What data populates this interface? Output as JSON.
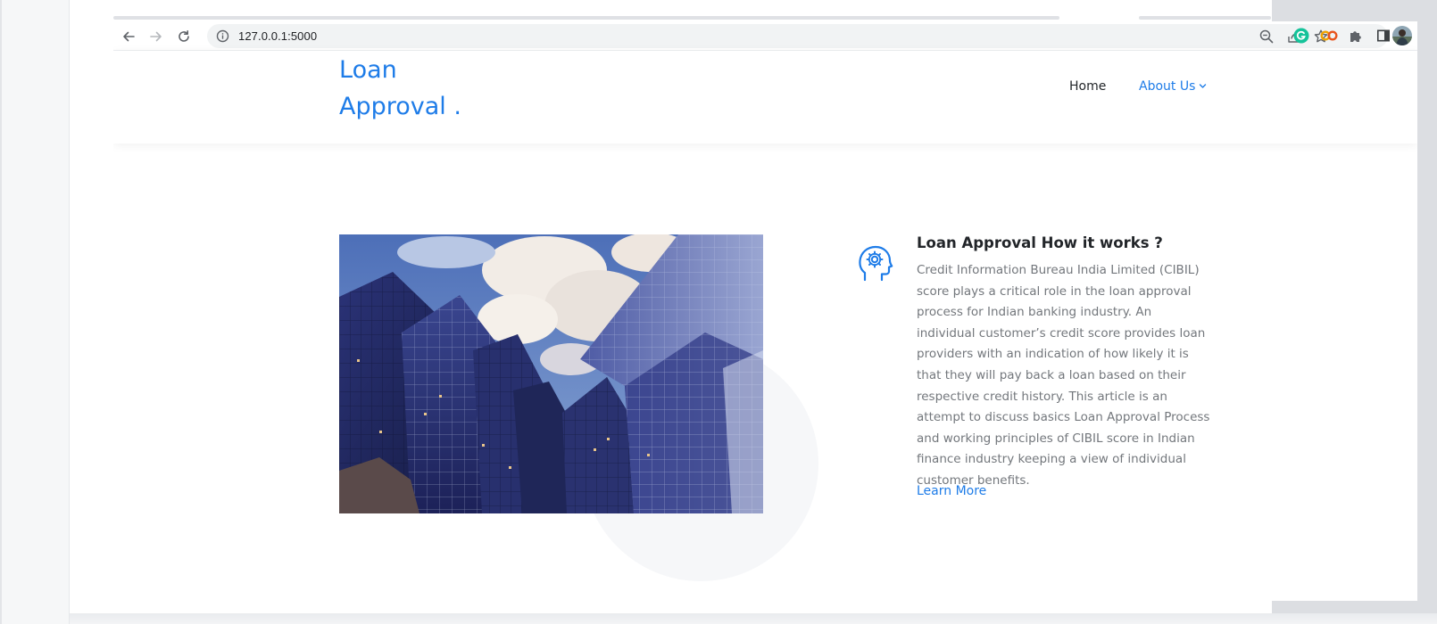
{
  "browser": {
    "url": "127.0.0.1:5000",
    "icons": [
      "back-arrow-icon",
      "forward-arrow-icon",
      "reload-icon",
      "site-info-icon",
      "zoom-icon",
      "share-icon",
      "bookmark-star-icon",
      "grammarly-icon",
      "coupon-extension-icon",
      "extensions-puzzle-icon",
      "side-panel-icon",
      "profile-avatar"
    ]
  },
  "header": {
    "logo_line1": "Loan",
    "logo_line2": "Approval .",
    "nav": {
      "home": "Home",
      "about": "About Us"
    }
  },
  "feature": {
    "title": "Loan Approval How it works ?",
    "body": "Credit Information Bureau India Limited (CIBIL) score plays a critical role in the loan approval process for Indian banking industry. An individual customer’s credit score provides loan providers with an indication of how likely it is that they will pay back a loan based on their respective credit history. This article is an attempt to discuss basics Loan Approval Process and working principles of CIBIL score in Indian finance industry keeping a view of individual customer benefits.",
    "link": "Learn More"
  },
  "colors": {
    "accent": "#1e7ce8",
    "text": "#222529",
    "muted": "#73777c"
  }
}
